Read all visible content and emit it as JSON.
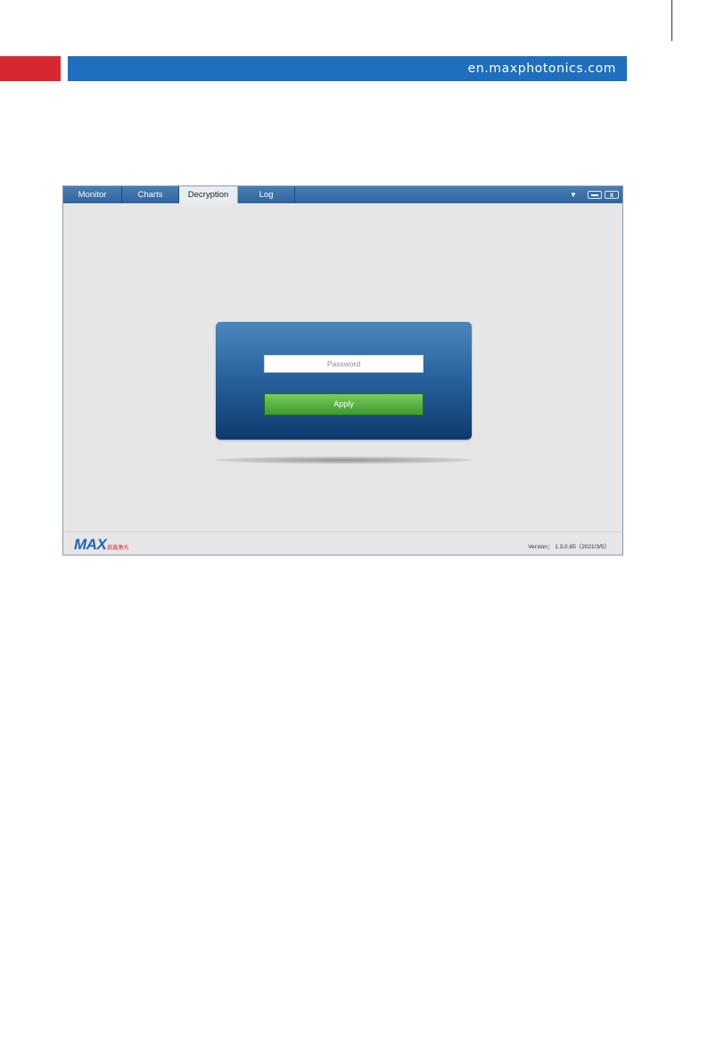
{
  "header": {
    "url": "en.maxphotonics.com"
  },
  "window": {
    "tabs": [
      {
        "label": "Monitor"
      },
      {
        "label": "Charts"
      },
      {
        "label": "Decryption"
      },
      {
        "label": "Log"
      }
    ],
    "active_tab": "Decryption",
    "dropdown_icon": "caret-down-icon",
    "minimize_icon": "minimize-icon",
    "close_label": "x"
  },
  "login": {
    "password_placeholder": "Password",
    "apply_label": "Apply"
  },
  "status": {
    "logo_text": "MAX",
    "logo_cn": "創鑫激光",
    "version_label": "Version：",
    "version_value": "1.3.0.65（2021/3/5）"
  },
  "colors": {
    "red_accent": "#d7282f",
    "blue_accent": "#1e6fbd",
    "apply_green": "#4caf3c"
  }
}
